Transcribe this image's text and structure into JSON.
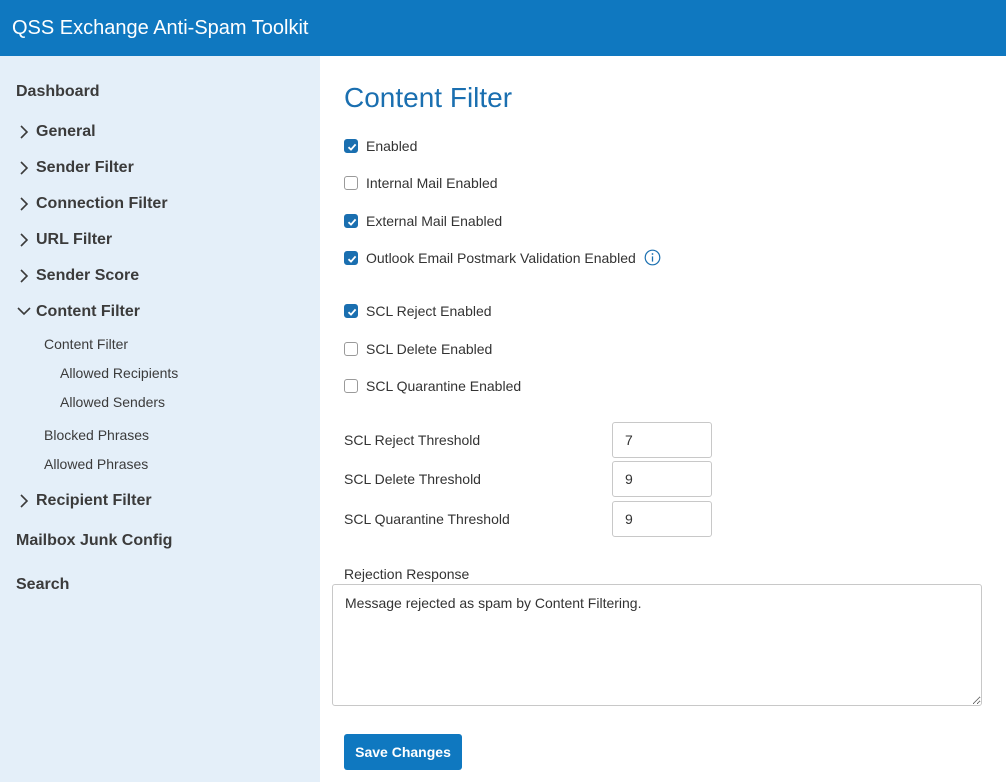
{
  "app": {
    "title": "QSS Exchange Anti-Spam Toolkit"
  },
  "sidebar": {
    "dashboard": "Dashboard",
    "groups": {
      "general": "General",
      "sender_filter": "Sender Filter",
      "connection_filter": "Connection Filter",
      "url_filter": "URL Filter",
      "sender_score": "Sender Score",
      "content_filter": "Content Filter",
      "recipient_filter": "Recipient Filter"
    },
    "content_filter_sub": {
      "content_filter": "Content Filter",
      "allowed_recipients": "Allowed Recipients",
      "allowed_senders": "Allowed Senders",
      "blocked_phrases": "Blocked Phrases",
      "allowed_phrases": "Allowed Phrases"
    },
    "mailbox_junk_config": "Mailbox Junk Config",
    "search": "Search"
  },
  "main": {
    "title": "Content Filter",
    "checkboxes": {
      "enabled": {
        "label": "Enabled",
        "checked": true
      },
      "internal_mail": {
        "label": "Internal Mail Enabled",
        "checked": false
      },
      "external_mail": {
        "label": "External Mail Enabled",
        "checked": true
      },
      "postmark": {
        "label": "Outlook Email Postmark Validation Enabled",
        "checked": true
      },
      "scl_reject": {
        "label": "SCL Reject Enabled",
        "checked": true
      },
      "scl_delete": {
        "label": "SCL Delete Enabled",
        "checked": false
      },
      "scl_quarantine": {
        "label": "SCL Quarantine Enabled",
        "checked": false
      }
    },
    "thresholds": {
      "reject": {
        "label": "SCL Reject Threshold",
        "value": "7"
      },
      "delete": {
        "label": "SCL Delete Threshold",
        "value": "9"
      },
      "quarantine": {
        "label": "SCL Quarantine Threshold",
        "value": "9"
      }
    },
    "rejection_response": {
      "label": "Rejection Response",
      "value": "Message rejected as spam by Content Filtering."
    },
    "save_label": "Save Changes"
  },
  "colors": {
    "topbar": "#0f78c0",
    "sidebar_bg": "#e4eff9",
    "title": "#1a6fb0",
    "checkbox_on": "#1a6fb0"
  },
  "icons": {
    "chevron_right": "chevron-right-icon",
    "chevron_down": "chevron-down-icon",
    "info": "info-icon",
    "check": "check-icon"
  }
}
